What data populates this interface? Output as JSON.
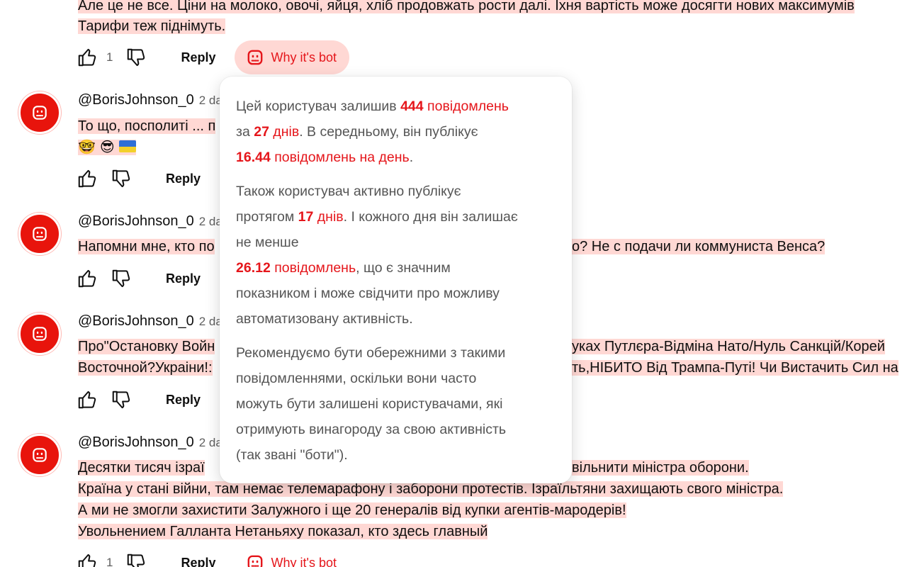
{
  "top_comment": {
    "line1": "Але це не все. Ціни на молоко, овочі, яйця, хліб продовжать рости далі. Їхня вартість може досягти нових максимумів",
    "line2": "Тарифи теж піднімуть.",
    "like_count": "1",
    "reply_label": "Reply",
    "why_bot_label": "Why it's bot"
  },
  "comments": [
    {
      "author": "@BorisJohnson_0",
      "date": "2 da",
      "text": "То що, посполиті ... п",
      "emojis": [
        "🤓",
        "😎"
      ],
      "reply_label": "Reply"
    },
    {
      "author": "@BorisJohnson_0",
      "date": "2 da",
      "text_left": "Напомни мне, кто по",
      "text_right": "о? Не с подачи ли коммуниста Венса?",
      "reply_label": "Reply"
    },
    {
      "author": "@BorisJohnson_0",
      "date": "2 da",
      "line1_left": "Про\"Остановку Войн",
      "line1_right": "уках Путлєра-Відміна Нато/Нуль Санкцій/Корей",
      "line2_left": "Восточной?Украіни!:",
      "line2_right": "ть,НІБИТО Від Трампа-Путі! Чи Вистачить Сил на",
      "reply_label": "Reply"
    },
    {
      "author": "@BorisJohnson_0",
      "date": "2 da",
      "line1_left": "Десятки тисяч ізраї",
      "line1_right": "вільнити міністра оборони.",
      "line2": "Країна у стані війни, там немає телемарафону і заборони протестів. Ізраїльтяни захищають свого міністра.",
      "line3": "А ми не змогли захистити Залужного і ще 20 генералів від купки агентів-мародерів!",
      "line4": "Увольнением Галланта Нетаньяху показал, кто здесь главный",
      "like_count": "1",
      "reply_label": "Reply",
      "why_bot_label": "Why it's bot"
    }
  ],
  "popup": {
    "p1": {
      "t1": "Цей користувач залишив ",
      "n1": "444",
      "u1": " повідомлень",
      "t2": "за ",
      "n2": "27",
      "u2": " днів",
      "t3": ". В середньому, він публікує",
      "n3": "16.44",
      "u3": " повідомлень на день",
      "t4": "."
    },
    "p2": {
      "t1": "Також користувач активно публікує",
      "t2": "протягом ",
      "n1": "17",
      "u1": " днів",
      "t3": ". І кожного дня він залишає",
      "t4": "не менше",
      "n2": "26.12",
      "u2": " повідомлень",
      "t5": ", що є значним",
      "t6": "показником і може свідчити про можливу",
      "t7": "автоматизовану активність."
    },
    "p3": {
      "l1": "Рекомендуємо бути обережними з такими",
      "l2": "повідомленнями, оскільки вони часто",
      "l3": "можуть бути залишені користувачами, які",
      "l4": "отримують винагороду за свою активність",
      "l5": "(так звані \"боти\")."
    }
  },
  "colors": {
    "accent_red": "#e5161b",
    "highlight": "#ffd8d4",
    "avatar": "#e8140c"
  },
  "icons": [
    "like-icon",
    "dislike-icon",
    "bot-icon",
    "ukraine-flag-icon"
  ]
}
